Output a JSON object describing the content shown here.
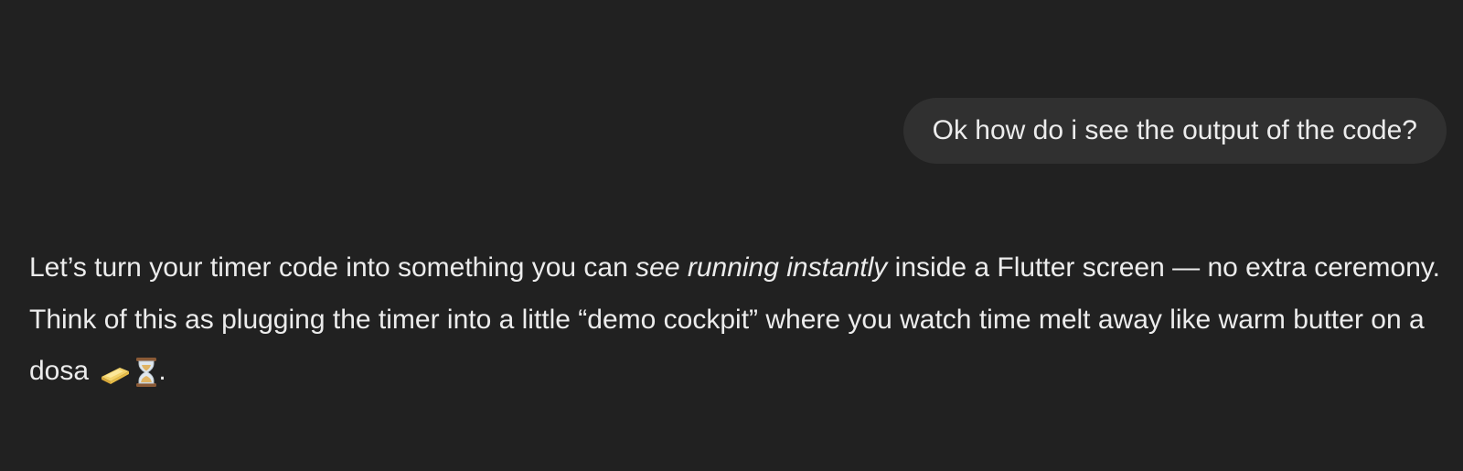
{
  "conversation": {
    "user_message": "Ok how do i see the output of the code?",
    "assistant_message": {
      "p1_before_em": "Let’s turn your timer code into something you can ",
      "p1_em": "see running instantly",
      "p1_after_em": " inside a Flutter screen — no extra ceremony.",
      "p2_text": "Think of this as plugging the timer into a little “demo cockpit” where you watch time melt away like warm butter on a dosa ",
      "p2_end": ".",
      "emojis": [
        "butter-icon",
        "hourglass-icon"
      ]
    }
  }
}
